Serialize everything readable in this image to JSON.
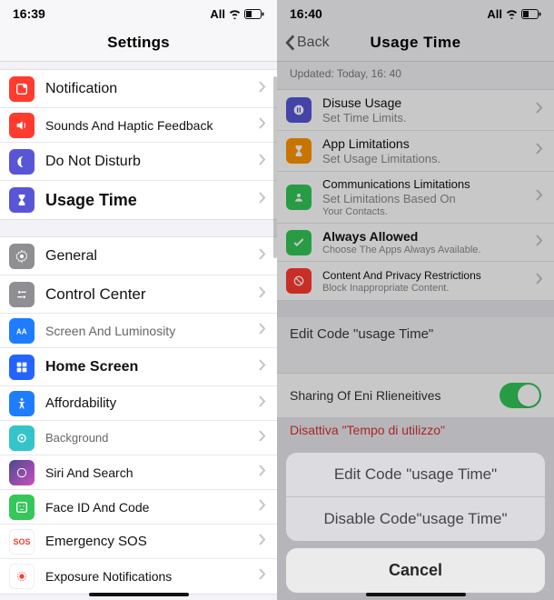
{
  "left": {
    "statusTime": "16:39",
    "statusNet": "All",
    "headerTitle": "Settings",
    "rows": [
      {
        "icon": "notification-icon",
        "color": "#ff3b30",
        "label": "Notification"
      },
      {
        "icon": "speaker-icon",
        "color": "#ff3b30",
        "label": "Sounds And Haptic Feedback"
      },
      {
        "icon": "moon-icon",
        "color": "#5856d6",
        "label": "Do Not Disturb"
      },
      {
        "icon": "hourglass-icon",
        "color": "#5856d6",
        "label": "Usage Time",
        "strong": true
      }
    ],
    "rows2": [
      {
        "icon": "gear-icon",
        "color": "#8e8e93",
        "label": "General"
      },
      {
        "icon": "sliders-icon",
        "color": "#8e8e93",
        "label": "Control Center"
      },
      {
        "icon": "text-size-icon",
        "color": "#1e7dff",
        "label": "Screen And Luminosity"
      },
      {
        "icon": "grid-icon",
        "color": "#2563ff",
        "label": "Home Screen",
        "strong": true
      },
      {
        "icon": "accessibility-icon",
        "color": "#1e7dff",
        "label": "Affordability"
      },
      {
        "icon": "wallpaper-icon",
        "color": "#34c4c9",
        "label": "Background"
      },
      {
        "icon": "siri-icon",
        "color": "#2b2b2f",
        "label": "Siri And Search"
      },
      {
        "icon": "faceid-icon",
        "color": "#34c759",
        "label": "Face ID And Code"
      },
      {
        "icon": "sos-icon",
        "color": "#ff3b30",
        "label": "Emergency SOS",
        "prefix": "SOS"
      },
      {
        "icon": "exposure-icon",
        "color": "#fff",
        "label": "Exposure Notifications"
      }
    ]
  },
  "right": {
    "statusTime": "16:40",
    "statusNet": "All",
    "backLabel": "Back",
    "headerTitle": "Usage Time",
    "updated": "Updated: Today, 16: 40",
    "items": [
      {
        "icon": "pause-icon",
        "color": "#5856d6",
        "title": "Disuse Usage",
        "sub": "Set Time Limits."
      },
      {
        "icon": "hourglass-icon",
        "color": "#ff9500",
        "title": "App Limitations",
        "sub": "Set Usage Limitations."
      },
      {
        "icon": "person-icon",
        "color": "#34c759",
        "title": "Communications Limitations",
        "sub": "Set Limitations Based On",
        "sub2": "Your Contacts."
      },
      {
        "icon": "check-icon",
        "color": "#34c759",
        "title": "Always Allowed",
        "sub": "Choose The Apps Always Available."
      },
      {
        "icon": "block-icon",
        "color": "#ff3b30",
        "title": "Content And Privacy Restrictions",
        "sub": "Block Inappropriate Content."
      }
    ],
    "editCodeLabel": "Edit Code \"usage Time\"",
    "sharingLabel": "Sharing Of Eni Rlieneitives",
    "redLine": "Disattiva \"Tempo di utilizzo\"",
    "sheet": {
      "edit": "Edit Code \"usage Time\"",
      "disable": "Disable Code\"usage Time\"",
      "cancel": "Cancel"
    }
  }
}
